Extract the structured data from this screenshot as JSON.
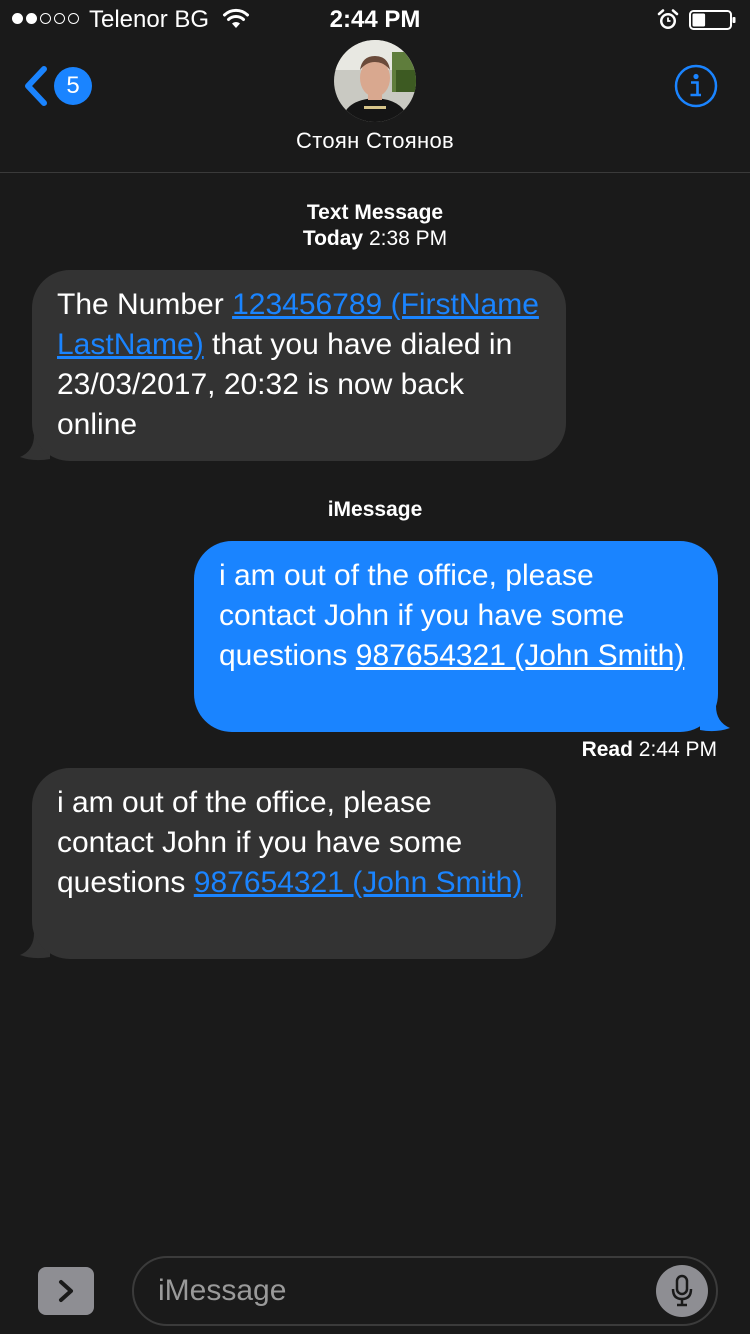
{
  "status_bar": {
    "signal_bars": [
      true,
      true,
      false,
      false,
      false
    ],
    "carrier": "Telenor BG",
    "time": "2:44 PM",
    "icons": [
      "wifi-icon",
      "alarm-icon",
      "battery-icon"
    ],
    "battery_level": 0.35
  },
  "header": {
    "back_badge": "5",
    "contact_name": "Стоян Стоянов",
    "icons": [
      "chevron-left-icon",
      "info-icon"
    ],
    "accent_color": "#1a84ff"
  },
  "conversation": {
    "sms_label": {
      "title": "Text Message",
      "day": "Today",
      "time": "2:38 PM"
    },
    "message_1": {
      "text_before": "The Number ",
      "link": "123456789 (FirstName LastName)",
      "text_after": " that you have dialed in 23/03/2017, 20:32 is now back online"
    },
    "imessage_label": "iMessage",
    "message_2": {
      "text_before": "i am out of the office, please contact John if you have some questions ",
      "link": "987654321 (John Smith)"
    },
    "read_receipt": {
      "label": "Read",
      "time": "2:44 PM"
    },
    "message_3": {
      "text_before": "i am out of the office, please contact John if you have some questions ",
      "link": "987654321 (John Smith)"
    }
  },
  "input_bar": {
    "placeholder": "iMessage",
    "value": "",
    "icons": [
      "chevron-right-icon",
      "microphone-icon"
    ]
  },
  "colors": {
    "background": "#1a1a1a",
    "incoming_bubble": "#333333",
    "outgoing_bubble": "#1a84ff",
    "link": "#1a84ff"
  }
}
